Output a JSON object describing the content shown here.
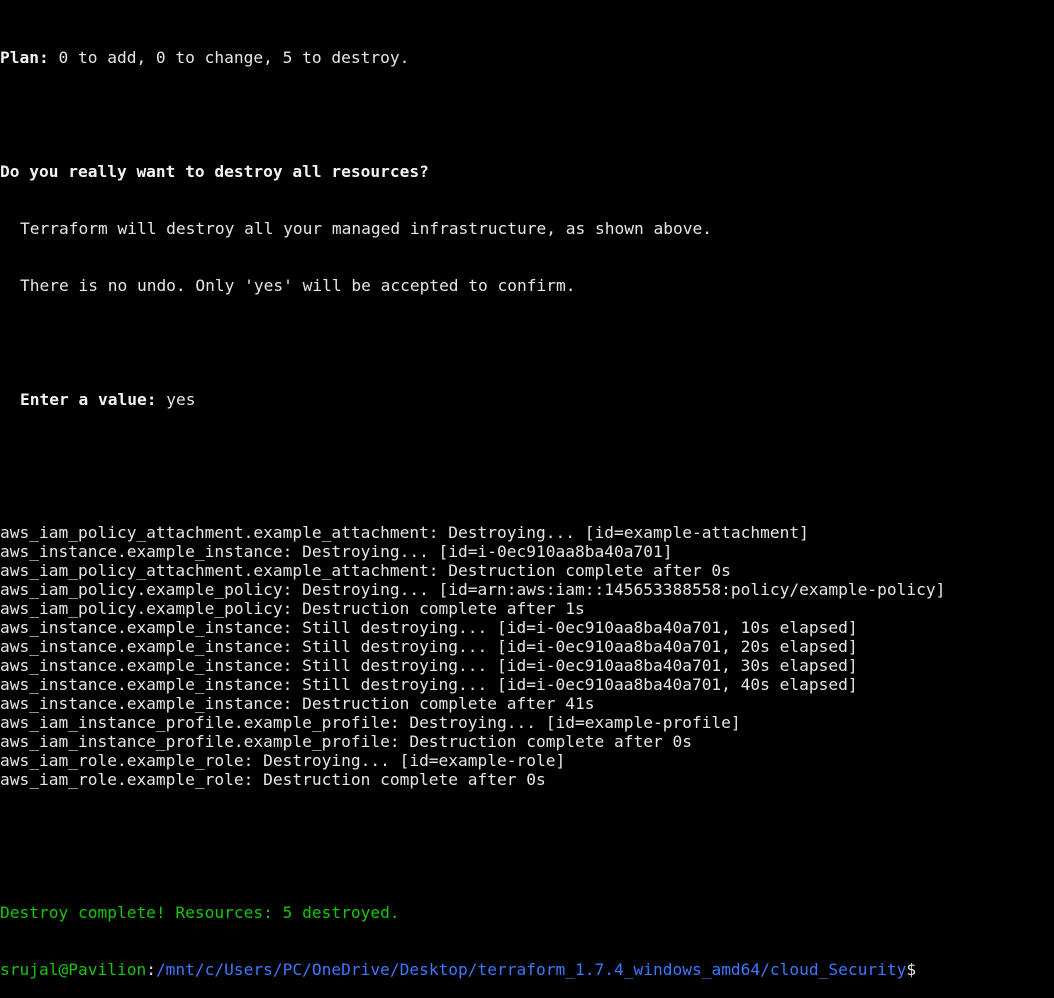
{
  "plan": {
    "label": "Plan:",
    "summary": " 0 to add, 0 to change, 5 to destroy."
  },
  "confirm": {
    "question": "Do you really want to destroy all resources?",
    "warning1": "Terraform will destroy all your managed infrastructure, as shown above.",
    "warning2": "There is no undo. Only 'yes' will be accepted to confirm.",
    "prompt_label": "Enter a value:",
    "prompt_value": " yes"
  },
  "log": [
    "aws_iam_policy_attachment.example_attachment: Destroying... [id=example-attachment]",
    "aws_instance.example_instance: Destroying... [id=i-0ec910aa8ba40a701]",
    "aws_iam_policy_attachment.example_attachment: Destruction complete after 0s",
    "aws_iam_policy.example_policy: Destroying... [id=arn:aws:iam::145653388558:policy/example-policy]",
    "aws_iam_policy.example_policy: Destruction complete after 1s",
    "aws_instance.example_instance: Still destroying... [id=i-0ec910aa8ba40a701, 10s elapsed]",
    "aws_instance.example_instance: Still destroying... [id=i-0ec910aa8ba40a701, 20s elapsed]",
    "aws_instance.example_instance: Still destroying... [id=i-0ec910aa8ba40a701, 30s elapsed]",
    "aws_instance.example_instance: Still destroying... [id=i-0ec910aa8ba40a701, 40s elapsed]",
    "aws_instance.example_instance: Destruction complete after 41s",
    "aws_iam_instance_profile.example_profile: Destroying... [id=example-profile]",
    "aws_iam_instance_profile.example_profile: Destruction complete after 0s",
    "aws_iam_role.example_role: Destroying... [id=example-role]",
    "aws_iam_role.example_role: Destruction complete after 0s"
  ],
  "result": {
    "text": "Destroy complete! Resources: 5 destroyed."
  },
  "shell": {
    "user_host": "srujal@Pavilion",
    "separator": ":",
    "cwd": "/mnt/c/Users/PC/OneDrive/Desktop/terraform_1.7.4_windows_amd64/cloud_Security",
    "prompt_symbol": "$"
  },
  "colors": {
    "background": "#000000",
    "text": "#e6e6e6",
    "success_green": "#16c60c",
    "path_blue": "#3b78ff"
  }
}
